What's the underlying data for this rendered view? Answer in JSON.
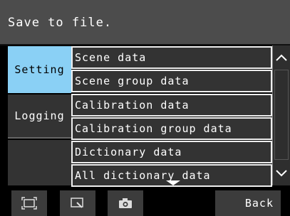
{
  "header": {
    "message": "Save to file."
  },
  "tabs": [
    {
      "label": "Setting",
      "active": true
    },
    {
      "label": "Logging",
      "active": false
    }
  ],
  "list": {
    "items": [
      {
        "label": "Scene data"
      },
      {
        "label": "Scene group data"
      },
      {
        "label": "Calibration data"
      },
      {
        "label": "Calibration group data"
      },
      {
        "label": "Dictionary data"
      },
      {
        "label": "All dictionary data"
      }
    ]
  },
  "scrollbar": {
    "up_icon": "chevron-up-icon",
    "down_icon": "chevron-down-icon"
  },
  "toolbar": {
    "fullscreen_icon": "fullscreen-icon",
    "zoom_icon": "zoom-window-icon",
    "capture_icon": "camera-icon",
    "back_label": "Back"
  },
  "colors": {
    "header_bg": "#4c4c4c",
    "active_tab_bg": "#8ad0f5",
    "item_bg": "#333333",
    "item_border": "#eeeeee"
  }
}
